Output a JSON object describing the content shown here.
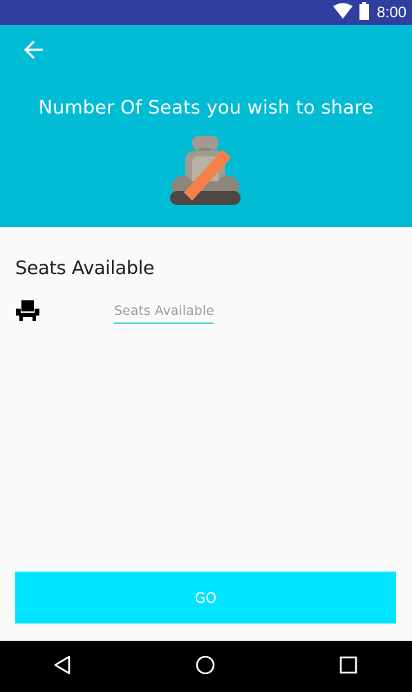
{
  "status_bar": {
    "time": "8:00",
    "icons": [
      "wifi-icon",
      "battery-icon"
    ]
  },
  "header": {
    "back_icon": "arrow-back-icon",
    "title": "Number Of Seats you wish to share",
    "illustration_icon": "car-seat-illustration",
    "background_color": "#00bcd4"
  },
  "form": {
    "section_label": "Seats Available",
    "seat_icon": "seat-icon",
    "input": {
      "value": "",
      "placeholder": "Seats Available"
    }
  },
  "go_button": {
    "label": "GO",
    "color": "#00e5ff"
  },
  "nav_bar": {
    "buttons": [
      "back-triangle-icon",
      "home-circle-icon",
      "recents-square-icon"
    ]
  }
}
